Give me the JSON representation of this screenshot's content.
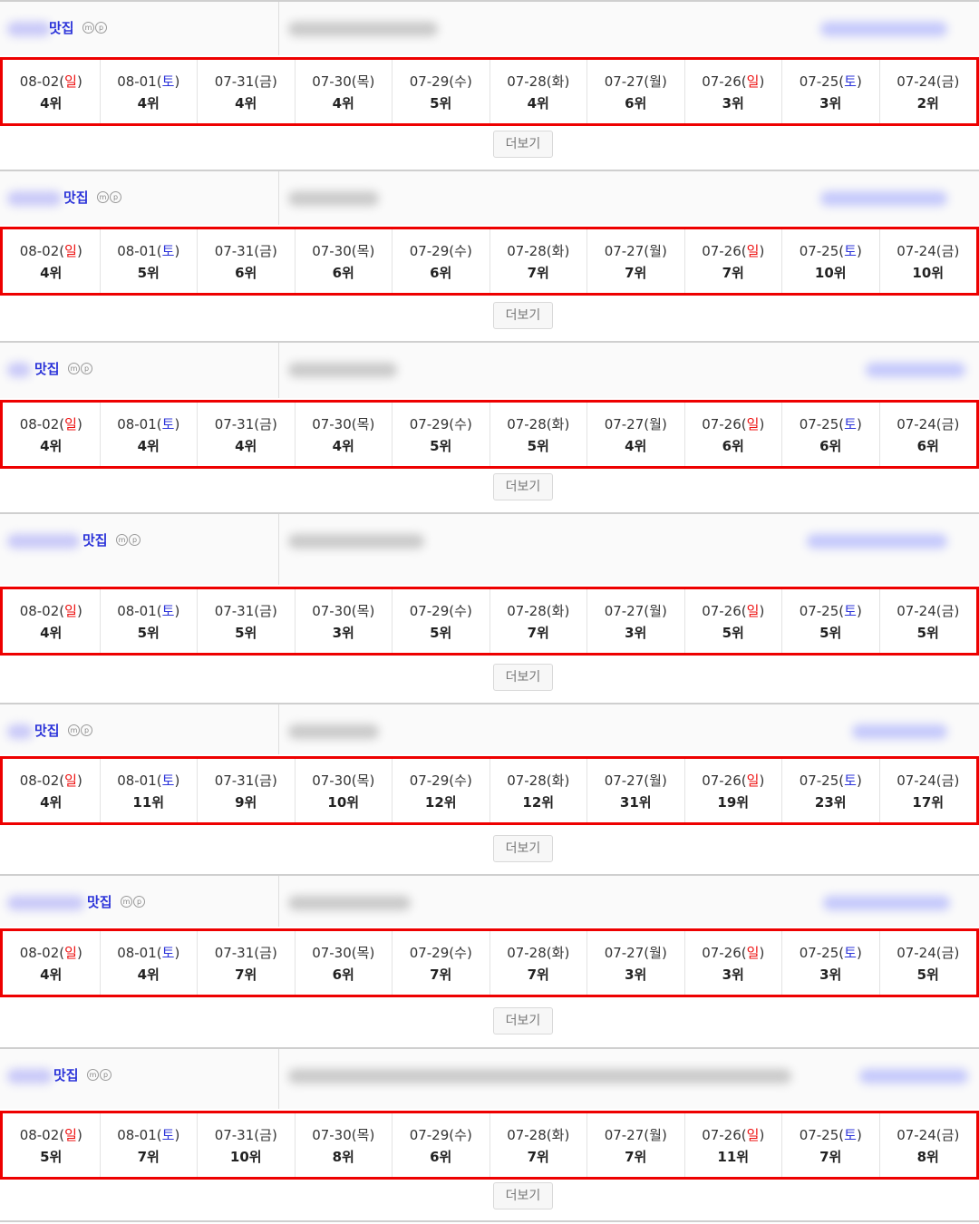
{
  "more_label": "더보기",
  "colors": {
    "saturday": "#2c34d9",
    "sunday": "#ee1111",
    "highlight_border": "#ee0000"
  },
  "keyword_suffix": "맛집",
  "mp_icons": [
    "m",
    "p"
  ],
  "dates": [
    {
      "d": "08-02(",
      "w": "일",
      "type": "sun"
    },
    {
      "d": "08-01(",
      "w": "토",
      "type": "sat"
    },
    {
      "d": "07-31(",
      "w": "금",
      "type": "wk"
    },
    {
      "d": "07-30(",
      "w": "목",
      "type": "wk"
    },
    {
      "d": "07-29(",
      "w": "수",
      "type": "wk"
    },
    {
      "d": "07-28(",
      "w": "화",
      "type": "wk"
    },
    {
      "d": "07-27(",
      "w": "월",
      "type": "wk"
    },
    {
      "d": "07-26(",
      "w": "일",
      "type": "sun"
    },
    {
      "d": "07-25(",
      "w": "토",
      "type": "sat"
    },
    {
      "d": "07-24(",
      "w": "금",
      "type": "wk"
    }
  ],
  "sections": [
    {
      "ranks": [
        "4위",
        "4위",
        "4위",
        "4위",
        "5위",
        "4위",
        "6위",
        "3위",
        "3위",
        "2위"
      ]
    },
    {
      "ranks": [
        "4위",
        "5위",
        "6위",
        "6위",
        "6위",
        "7위",
        "7위",
        "7위",
        "10위",
        "10위"
      ]
    },
    {
      "ranks": [
        "4위",
        "4위",
        "4위",
        "4위",
        "5위",
        "5위",
        "4위",
        "6위",
        "6위",
        "6위"
      ]
    },
    {
      "ranks": [
        "4위",
        "5위",
        "5위",
        "3위",
        "5위",
        "7위",
        "3위",
        "5위",
        "5위",
        "5위"
      ]
    },
    {
      "ranks": [
        "4위",
        "11위",
        "9위",
        "10위",
        "12위",
        "12위",
        "31위",
        "19위",
        "23위",
        "17위"
      ]
    },
    {
      "ranks": [
        "4위",
        "4위",
        "7위",
        "6위",
        "7위",
        "7위",
        "3위",
        "3위",
        "3위",
        "5위"
      ]
    },
    {
      "ranks": [
        "5위",
        "7위",
        "10위",
        "8위",
        "6위",
        "7위",
        "7위",
        "11위",
        "7위",
        "8위"
      ]
    }
  ]
}
